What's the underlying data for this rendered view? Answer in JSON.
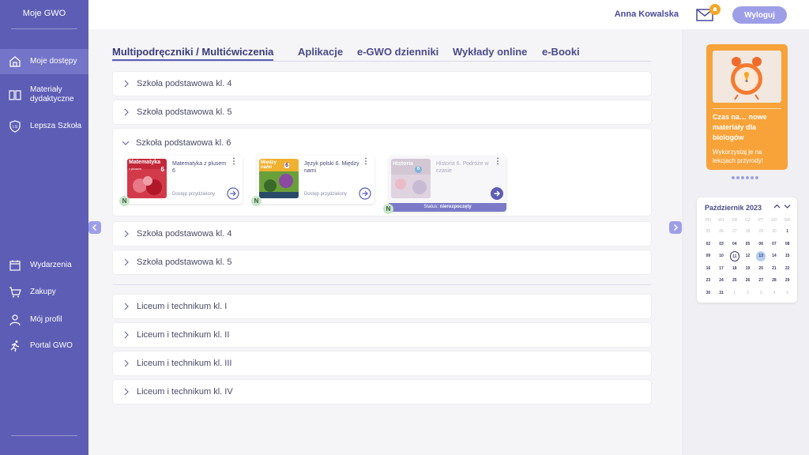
{
  "sidebar": {
    "logo": "Moje GWO",
    "items": [
      {
        "label": "Moje dostępy",
        "icon": "home-icon"
      },
      {
        "label": "Materiały dydaktyczne",
        "icon": "book-icon"
      },
      {
        "label": "Lepsza Szkoła",
        "icon": "shield-icon"
      },
      {
        "label": "Wydarzenia",
        "icon": "calendar-icon"
      },
      {
        "label": "Zakupy",
        "icon": "cart-icon"
      },
      {
        "label": "Mój profil",
        "icon": "user-icon"
      },
      {
        "label": "Portal GWO",
        "icon": "runner-icon"
      }
    ]
  },
  "header": {
    "user_name": "Anna Kowalska",
    "logout_label": "Wyloguj",
    "mail_icon": "mail-icon",
    "bell_icon": "bell-icon"
  },
  "tabs": [
    {
      "label": "Multipodręczniki / Multićwiczenia",
      "active": true
    },
    {
      "label": "Aplikacje"
    },
    {
      "label": "e-GWO dzienniki"
    },
    {
      "label": "Wykłady online"
    },
    {
      "label": "e-Booki"
    }
  ],
  "accordions_top": [
    {
      "label": "Szkoła podstawowa kl. 4"
    },
    {
      "label": "Szkoła podstawowa kl. 5"
    }
  ],
  "open_accordion": {
    "label": "Szkoła podstawowa kl. 6",
    "cards": [
      {
        "cover_title": "Matematyka",
        "cover_num": "6",
        "cover_sub": "z plusem",
        "title": "Matematyka z plusem 6",
        "status": "Dostęp przydzielony",
        "badge": "N"
      },
      {
        "cover_title": "Między nami",
        "cover_num": "6",
        "title": "Język polski 6. Między nami",
        "status": "Dostęp przydzielony",
        "badge": "N"
      },
      {
        "cover_title": "Historia",
        "cover_num": "6",
        "title": "Historia 6. Podróże w czasie",
        "status_prefix": "Status:",
        "status": "nierozpoczęty",
        "badge": "N"
      }
    ]
  },
  "accordions_mid": [
    {
      "label": "Szkoła podstawowa kl. 4"
    },
    {
      "label": "Szkoła podstawowa kl. 5"
    }
  ],
  "accordions_bottom": [
    {
      "label": "Liceum i technikum kl. I"
    },
    {
      "label": "Liceum i technikum kl. II"
    },
    {
      "label": "Liceum i technikum kl. III"
    },
    {
      "label": "Liceum i technikum kl. IV"
    }
  ],
  "promo": {
    "title": "Czas na… nowe materiały dla biologów",
    "description": "Wykorzystaj je na lekcjach przyrody!"
  },
  "calendar": {
    "month": "Październik 2023",
    "weekdays": [
      "PN",
      "WT",
      "ŚR",
      "CZ",
      "PT",
      "SO",
      "ND"
    ],
    "days": [
      {
        "d": "25",
        "o": true
      },
      {
        "d": "26",
        "o": true
      },
      {
        "d": "27",
        "o": true
      },
      {
        "d": "28",
        "o": true
      },
      {
        "d": "29",
        "o": true
      },
      {
        "d": "30",
        "o": true
      },
      {
        "d": "1"
      },
      {
        "d": "02"
      },
      {
        "d": "03"
      },
      {
        "d": "04"
      },
      {
        "d": "05"
      },
      {
        "d": "06"
      },
      {
        "d": "07"
      },
      {
        "d": "08"
      },
      {
        "d": "09"
      },
      {
        "d": "10"
      },
      {
        "d": "11",
        "today": true
      },
      {
        "d": "12"
      },
      {
        "d": "13",
        "sel": true
      },
      {
        "d": "14"
      },
      {
        "d": "15"
      },
      {
        "d": "16"
      },
      {
        "d": "17"
      },
      {
        "d": "18"
      },
      {
        "d": "19"
      },
      {
        "d": "20"
      },
      {
        "d": "21"
      },
      {
        "d": "22"
      },
      {
        "d": "23"
      },
      {
        "d": "24"
      },
      {
        "d": "25"
      },
      {
        "d": "26"
      },
      {
        "d": "27"
      },
      {
        "d": "28"
      },
      {
        "d": "29"
      },
      {
        "d": "30"
      },
      {
        "d": "31"
      },
      {
        "d": "1",
        "o": true
      },
      {
        "d": "2",
        "o": true
      },
      {
        "d": "3",
        "o": true
      },
      {
        "d": "4",
        "o": true
      },
      {
        "d": "5",
        "o": true
      }
    ]
  },
  "colors": {
    "accent": "#5d5db6",
    "promo": "#f7a33a"
  }
}
